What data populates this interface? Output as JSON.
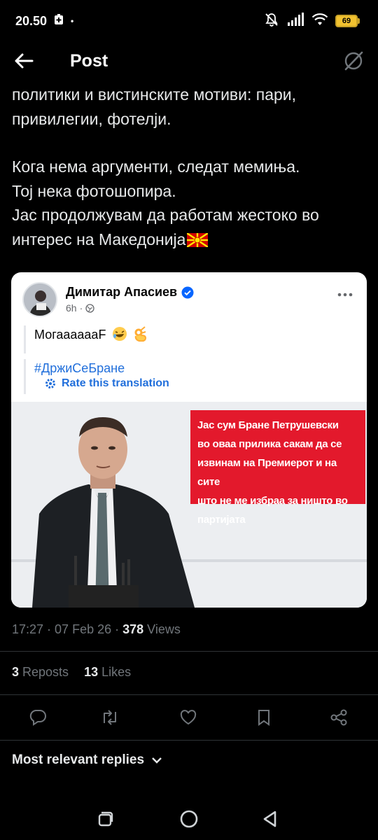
{
  "status_bar": {
    "time": "20.50",
    "dot": "•",
    "battery_level": "69",
    "accent": "#f2c230"
  },
  "header": {
    "title": "Post"
  },
  "post": {
    "lines": [
      "политики и вистинските мотиви: пари,",
      "привилегии, фотелји.",
      "Кога нема аргументи, следат мемиња.",
      "Тој нека фотошопира.",
      "Јас продолжувам да работам жестоко во",
      "интерес на Македонија"
    ],
    "time": "17:27",
    "sep": " · ",
    "date": "07 Feb 26",
    "views_count": "378",
    "views_label": " Views",
    "reposts_count": "3",
    "reposts_label": " Reposts",
    "likes_count": "13",
    "likes_label": " Likes"
  },
  "quoted": {
    "author": "Димитар Апасиев",
    "time": "6h",
    "sep": "·",
    "text": "МогааааааF",
    "hashtag": "#ДржиСеБране",
    "rate": "Rate this translation",
    "image_caption_lines": [
      "Јас сум Бране Петрушевски",
      "во оваа прилика сакам да се",
      "извинам на Премиерот и на сите",
      "што не ме избраа за ништо во",
      "партијата"
    ],
    "accent": "#216fdb",
    "caption_bg": "#e3192c"
  },
  "replies": {
    "filter_label": "Most relevant replies"
  }
}
